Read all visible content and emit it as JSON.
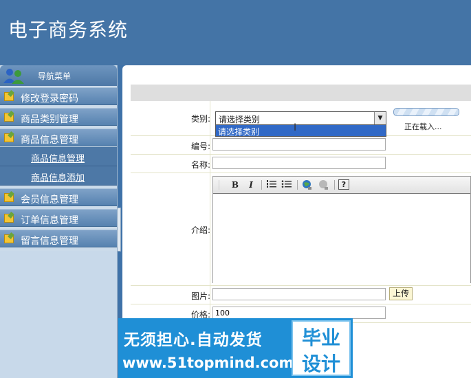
{
  "app": {
    "title": "电子商务系统"
  },
  "sidebar": {
    "header_label": "导航菜单",
    "items": [
      {
        "label": "修改登录密码"
      },
      {
        "label": "商品类别管理"
      },
      {
        "label": "商品信息管理"
      },
      {
        "label": "会员信息管理"
      },
      {
        "label": "订单信息管理"
      },
      {
        "label": "留言信息管理"
      }
    ],
    "subitems": [
      {
        "label": "商品信息管理"
      },
      {
        "label": "商品信息添加"
      }
    ]
  },
  "form": {
    "category": {
      "label": "类别:",
      "selected": "请选择类别",
      "dropdown_option": "请选择类别"
    },
    "loading_text": "正在载入...",
    "code": {
      "label": "编号:",
      "value": ""
    },
    "name": {
      "label": "名称:",
      "value": ""
    },
    "intro": {
      "label": "介绍:",
      "toolbar": {
        "bold": "B",
        "italic": "I",
        "help": "?"
      }
    },
    "image": {
      "label": "图片:",
      "value": "",
      "upload_label": "上传"
    },
    "price": {
      "label": "价格:",
      "value": "100"
    }
  },
  "watermark": {
    "line1": "无须担心.自动发货",
    "line2": "www.51topmind.com",
    "box_line1": "毕业",
    "box_line2": "设计"
  }
}
